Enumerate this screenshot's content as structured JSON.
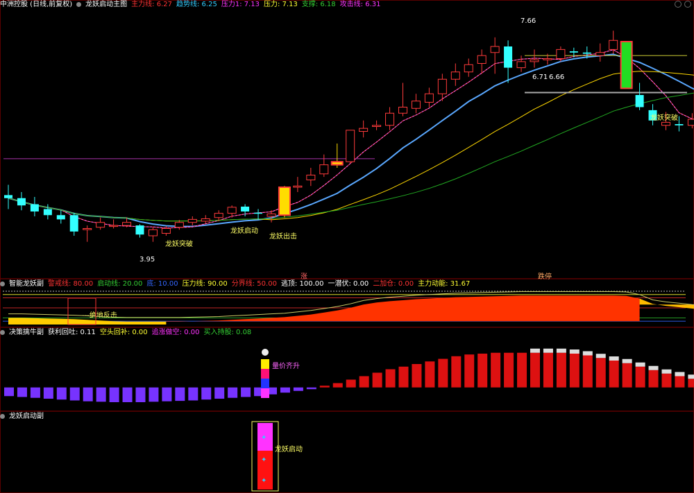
{
  "main_header": {
    "stock": "中洲控股 (日线,前复权)",
    "indicator": "龙妖启动主图",
    "items": [
      {
        "label": "主力线: 6.27",
        "color": "#ff3333"
      },
      {
        "label": "趋势线: 6.25",
        "color": "#33ccff"
      },
      {
        "label": "压力1: 7.13",
        "color": "#ff33ff"
      },
      {
        "label": "压力: 7.13",
        "color": "#ffff33"
      },
      {
        "label": "支撑: 6.18",
        "color": "#33cc33"
      },
      {
        "label": "攻击线: 6.31",
        "color": "#ff33ff"
      }
    ]
  },
  "sub1_header": {
    "indicator": "智能龙妖副",
    "items": [
      {
        "label": "警戒线: 80.00",
        "color": "#ff3333"
      },
      {
        "label": "启动线: 20.00",
        "color": "#33cc33"
      },
      {
        "label": "底: 10.00",
        "color": "#3366ff"
      },
      {
        "label": "压力线: 90.00",
        "color": "#ffff33"
      },
      {
        "label": "分界线: 50.00",
        "color": "#ff3333"
      },
      {
        "label": "逃顶: 100.00",
        "color": "#ffffff"
      },
      {
        "label": "一潜伏: 0.00",
        "color": "#ffffff"
      },
      {
        "label": "二加仓: 0.00",
        "color": "#ff3333"
      },
      {
        "label": "主力动能: 31.67",
        "color": "#ffff33"
      }
    ]
  },
  "sub2_header": {
    "indicator": "决策擒牛副",
    "items": [
      {
        "label": "获利回吐: 0.11",
        "color": "#ffffff"
      },
      {
        "label": "空头回补: 0.00",
        "color": "#ffff33"
      },
      {
        "label": "追涨做空: 0.00",
        "color": "#ff33ff"
      },
      {
        "label": "买入持股: 0.08",
        "color": "#33cc33"
      }
    ]
  },
  "sub3_header": {
    "indicator": "龙妖启动副"
  },
  "labels": {
    "high": "7.66",
    "low": "3.95",
    "lvl1": "6.71",
    "lvl2": "6.66",
    "breakout1": "龙妖突破",
    "breakout2": "龙妖突破",
    "launch": "龙妖启动",
    "exit": "龙妖出击",
    "zhang": "涨",
    "dieting": "跌停",
    "reversal": "---绝地反击",
    "price_rise": "量价齐升",
    "launch_sub": "龙妖启动"
  },
  "colors": {
    "up": "#ff3b3b",
    "down": "#33ffff",
    "bg": "#000000"
  },
  "chart_data": [
    {
      "type": "candlestick",
      "title": "龙妖启动主图",
      "ylim": [
        3.8,
        7.8
      ],
      "candles": [
        [
          4.95,
          4.9,
          5.12,
          4.72
        ],
        [
          4.9,
          4.78,
          5.0,
          4.7
        ],
        [
          4.8,
          4.68,
          4.92,
          4.6
        ],
        [
          4.72,
          4.62,
          4.8,
          4.55
        ],
        [
          4.62,
          4.55,
          4.7,
          4.48
        ],
        [
          4.62,
          4.35,
          4.66,
          4.28
        ],
        [
          4.38,
          4.4,
          4.45,
          4.18
        ],
        [
          4.42,
          4.5,
          4.58,
          4.38
        ],
        [
          4.45,
          4.45,
          4.55,
          4.4
        ],
        [
          4.45,
          4.5,
          4.58,
          4.42
        ],
        [
          4.45,
          4.3,
          4.47,
          4.25
        ],
        [
          4.28,
          4.38,
          4.42,
          4.18
        ],
        [
          4.32,
          4.4,
          4.44,
          4.28
        ],
        [
          4.42,
          4.5,
          4.54,
          4.38
        ],
        [
          4.5,
          4.55,
          4.6,
          4.45
        ],
        [
          4.52,
          4.56,
          4.62,
          4.48
        ],
        [
          4.58,
          4.65,
          4.7,
          4.52
        ],
        [
          4.65,
          4.75,
          4.78,
          4.58
        ],
        [
          4.76,
          4.68,
          4.8,
          4.6
        ],
        [
          4.66,
          4.65,
          4.72,
          4.55
        ],
        [
          4.6,
          4.64,
          4.7,
          4.5
        ],
        [
          4.62,
          5.08,
          5.1,
          4.58
        ],
        [
          5.08,
          5.1,
          5.25,
          5.0
        ],
        [
          5.2,
          5.28,
          5.4,
          5.1
        ],
        [
          5.3,
          5.45,
          5.62,
          5.25
        ],
        [
          5.45,
          5.5,
          5.8,
          5.4
        ],
        [
          5.5,
          6.02,
          6.02,
          5.48
        ],
        [
          6.0,
          6.05,
          6.18,
          5.9
        ],
        [
          6.08,
          6.1,
          6.18,
          6.02
        ],
        [
          6.1,
          6.3,
          6.4,
          6.02
        ],
        [
          6.3,
          6.4,
          6.8,
          6.25
        ],
        [
          6.38,
          6.5,
          6.62,
          6.3
        ],
        [
          6.48,
          6.62,
          6.72,
          6.4
        ],
        [
          6.62,
          6.86,
          6.95,
          6.5
        ],
        [
          6.86,
          6.98,
          7.12,
          6.75
        ],
        [
          6.98,
          7.1,
          7.2,
          6.9
        ],
        [
          7.12,
          7.25,
          7.35,
          6.95
        ],
        [
          7.3,
          7.4,
          7.55,
          6.95
        ],
        [
          7.4,
          7.05,
          7.5,
          6.8
        ],
        [
          7.05,
          7.15,
          7.25,
          6.98
        ],
        [
          7.15,
          7.18,
          7.35,
          7.05
        ],
        [
          7.18,
          7.2,
          7.28,
          7.1
        ],
        [
          7.2,
          7.35,
          7.4,
          7.15
        ],
        [
          7.32,
          7.3,
          7.38,
          7.22
        ],
        [
          7.3,
          7.28,
          7.4,
          7.2
        ],
        [
          7.25,
          7.3,
          7.45,
          7.15
        ],
        [
          7.35,
          7.5,
          7.66,
          7.28
        ],
        [
          7.48,
          6.71,
          7.48,
          6.71
        ],
        [
          6.6,
          6.4,
          6.8,
          6.35
        ],
        [
          6.35,
          6.18,
          6.45,
          6.1
        ],
        [
          6.1,
          6.15,
          6.32,
          6.02
        ],
        [
          6.12,
          6.1,
          6.25,
          6.0
        ],
        [
          6.1,
          6.2,
          6.3,
          6.05
        ],
        [
          6.2,
          6.3,
          6.45,
          6.15
        ],
        [
          6.32,
          6.4,
          6.48,
          6.25
        ],
        [
          6.4,
          6.35,
          6.48,
          6.28
        ],
        [
          6.35,
          6.42,
          6.5,
          6.3
        ],
        [
          6.4,
          6.48,
          6.55,
          6.35
        ],
        [
          6.45,
          6.55,
          6.6,
          6.38
        ],
        [
          6.52,
          6.62,
          6.7,
          6.48
        ],
        [
          6.6,
          6.75,
          6.92,
          6.55
        ]
      ]
    },
    {
      "type": "area",
      "title": "智能龙妖副",
      "ylim": [
        0,
        100
      ],
      "series": [
        {
          "name": "主力动能",
          "values": [
            20,
            20,
            19,
            18,
            17,
            16,
            14,
            12,
            10,
            9,
            9,
            9,
            9,
            9,
            10,
            11,
            12,
            14,
            16,
            18,
            20,
            22,
            26,
            30,
            36,
            42,
            50,
            60,
            66,
            70,
            73,
            76,
            78,
            80,
            82,
            83,
            84,
            85,
            86,
            87,
            87,
            87,
            87,
            87,
            87,
            87,
            87,
            86,
            78,
            62,
            56,
            52,
            48,
            45,
            42,
            40,
            38,
            36,
            34,
            32,
            31.67
          ]
        }
      ]
    },
    {
      "type": "bar",
      "title": "决策擒牛副",
      "ylim": [
        -25,
        55
      ],
      "values": [
        -10,
        -11,
        -12,
        -13,
        -14,
        -15,
        -16,
        -16.5,
        -17,
        -17,
        -17,
        -16.5,
        -16,
        -15.5,
        -15,
        -14,
        -13,
        -12,
        -11,
        -10,
        -8,
        -6,
        -4,
        -2,
        2,
        5,
        9,
        13,
        17,
        21,
        24,
        27,
        30,
        33,
        36,
        38,
        39,
        40,
        40,
        40,
        40,
        40,
        40,
        39,
        37,
        34,
        31,
        28,
        24,
        20,
        16,
        13,
        10,
        8,
        6,
        5,
        4,
        4,
        3,
        3,
        3
      ]
    }
  ]
}
